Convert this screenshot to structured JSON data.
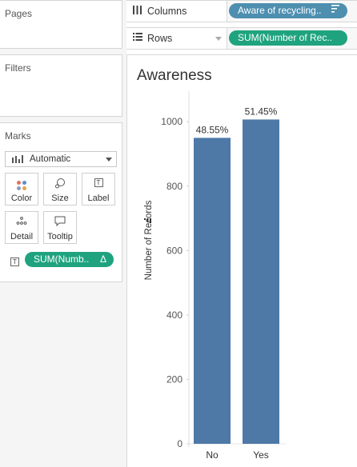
{
  "left_pane": {
    "pages_title": "Pages",
    "filters_title": "Filters",
    "marks_title": "Marks",
    "mark_type": "Automatic",
    "buttons": {
      "color": "Color",
      "size": "Size",
      "label": "Label",
      "detail": "Detail",
      "tooltip": "Tooltip"
    },
    "marks_field": "SUM(Numb..",
    "marks_field_delta": "Δ"
  },
  "shelves": {
    "columns_label": "Columns",
    "columns_pill": "Aware of recycling..",
    "rows_label": "Rows",
    "rows_pill": "SUM(Number of Rec.."
  },
  "view": {
    "title": "Awareness"
  },
  "chart_data": {
    "type": "bar",
    "title": "Awareness",
    "xlabel": "",
    "ylabel": "Number of Records",
    "categories": [
      "No",
      "Yes"
    ],
    "values": [
      950,
      1007
    ],
    "data_labels": [
      "48.55%",
      "51.45%"
    ],
    "yticks": [
      0,
      200,
      400,
      600,
      800,
      1000
    ],
    "ylim": [
      0,
      1090
    ],
    "bar_color": "#4e79a7",
    "grid": false
  },
  "colors": {
    "dimension_pill": "#4e8fb0",
    "measure_pill": "#1fa37f"
  }
}
